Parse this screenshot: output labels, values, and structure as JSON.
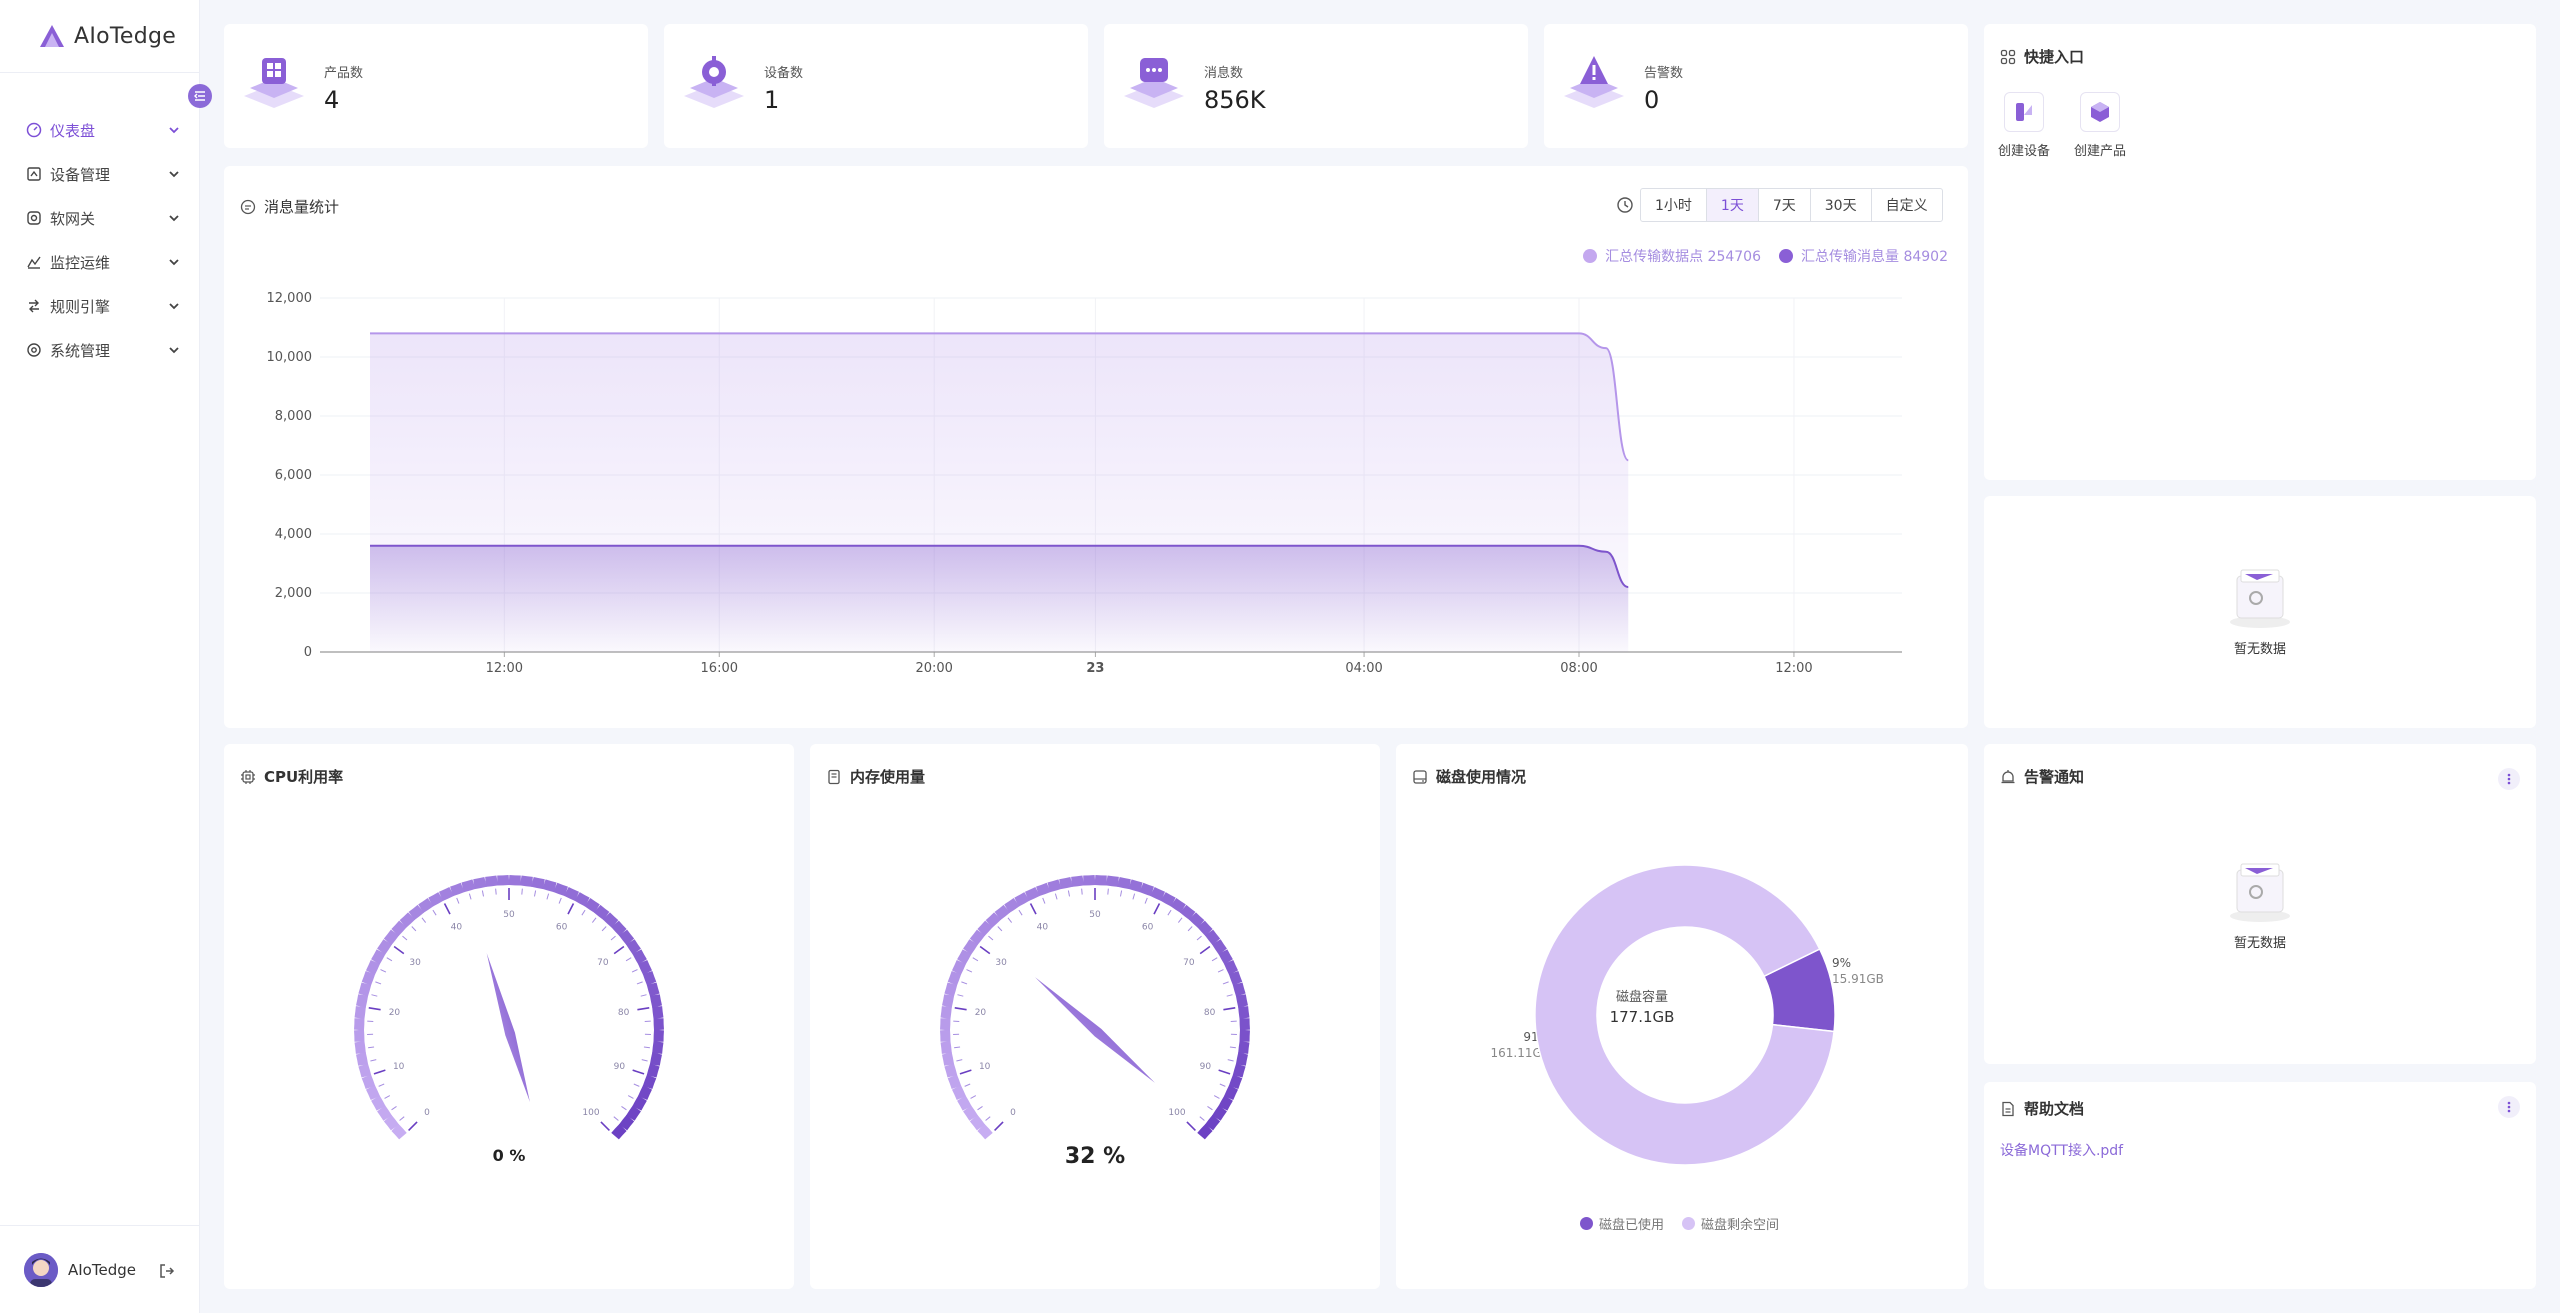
{
  "app": {
    "logo_text": "AIoTedge"
  },
  "sidebar": {
    "items": [
      {
        "label": "仪表盘",
        "icon": "dashboard-icon",
        "active": true
      },
      {
        "label": "设备管理",
        "icon": "device-icon",
        "active": false
      },
      {
        "label": "软网关",
        "icon": "gateway-icon",
        "active": false
      },
      {
        "label": "监控运维",
        "icon": "monitor-icon",
        "active": false
      },
      {
        "label": "规则引擎",
        "icon": "rule-icon",
        "active": false
      },
      {
        "label": "系统管理",
        "icon": "settings-icon",
        "active": false
      }
    ],
    "user_name": "AIoTedge"
  },
  "stats": [
    {
      "label": "产品数",
      "value": "4",
      "icon": "product-icon"
    },
    {
      "label": "设备数",
      "value": "1",
      "icon": "device-chip-icon"
    },
    {
      "label": "消息数",
      "value": "856K",
      "icon": "message-icon"
    },
    {
      "label": "告警数",
      "value": "0",
      "icon": "alert-icon"
    }
  ],
  "message_stats": {
    "title": "消息量统计",
    "ranges": [
      "1小时",
      "1天",
      "7天",
      "30天",
      "自定义"
    ],
    "selected_range": "1天",
    "legend": [
      {
        "label": "汇总传输数据点 254706",
        "color": "#c4a8ef"
      },
      {
        "label": "汇总传输消息量 84902",
        "color": "#8a5fd6"
      }
    ]
  },
  "chart_data": {
    "type": "area",
    "x_ticks": [
      "12:00",
      "16:00",
      "20:00",
      "23",
      "04:00",
      "08:00",
      "12:00"
    ],
    "ylim": [
      0,
      12000
    ],
    "y_ticks": [
      "0",
      "2,000",
      "4,000",
      "6,000",
      "8,000",
      "10,000",
      "12,000"
    ],
    "x": [
      "09:30",
      "10:00",
      "12:00",
      "16:00",
      "20:00",
      "00:00",
      "04:00",
      "08:00",
      "08:30",
      "08:55"
    ],
    "series": [
      {
        "name": "汇总传输数据点",
        "values": [
          10800,
          10800,
          10800,
          10800,
          10800,
          10800,
          10800,
          10800,
          10300,
          6500
        ],
        "color": "#b596ea"
      },
      {
        "name": "汇总传输消息量",
        "values": [
          3600,
          3600,
          3600,
          3600,
          3600,
          3600,
          3600,
          3600,
          3400,
          2200
        ],
        "color": "#7e55cc"
      }
    ]
  },
  "quick_entry": {
    "title": "快捷入口",
    "items": [
      {
        "label": "创建设备",
        "icon": "create-device-icon"
      },
      {
        "label": "创建产品",
        "icon": "create-product-icon"
      }
    ]
  },
  "empty_text": "暂无数据",
  "cpu": {
    "title": "CPU利用率",
    "value": 0,
    "display": "0 %",
    "ticks": [
      "0",
      "10",
      "20",
      "30",
      "40",
      "50",
      "60",
      "70",
      "80",
      "90",
      "100"
    ]
  },
  "memory": {
    "title": "内存使用量",
    "value": 32,
    "display": "32 %",
    "ticks": [
      "0",
      "10",
      "20",
      "30",
      "40",
      "50",
      "60",
      "70",
      "80",
      "90",
      "100"
    ]
  },
  "disk": {
    "title": "磁盘使用情况",
    "center_label": "磁盘容量",
    "center_value": "177.1GB",
    "used_pct": "9%",
    "used_size": "15.91GB",
    "free_pct": "91%",
    "free_size": "161.11GB",
    "used_fraction": 0.09,
    "legend_used": "磁盘已使用",
    "legend_free": "磁盘剩余空间",
    "colors": {
      "used": "#7e55cc",
      "free": "#d6c3f5"
    }
  },
  "alarm": {
    "title": "告警通知"
  },
  "help": {
    "title": "帮助文档",
    "link": "设备MQTT接入.pdf"
  }
}
